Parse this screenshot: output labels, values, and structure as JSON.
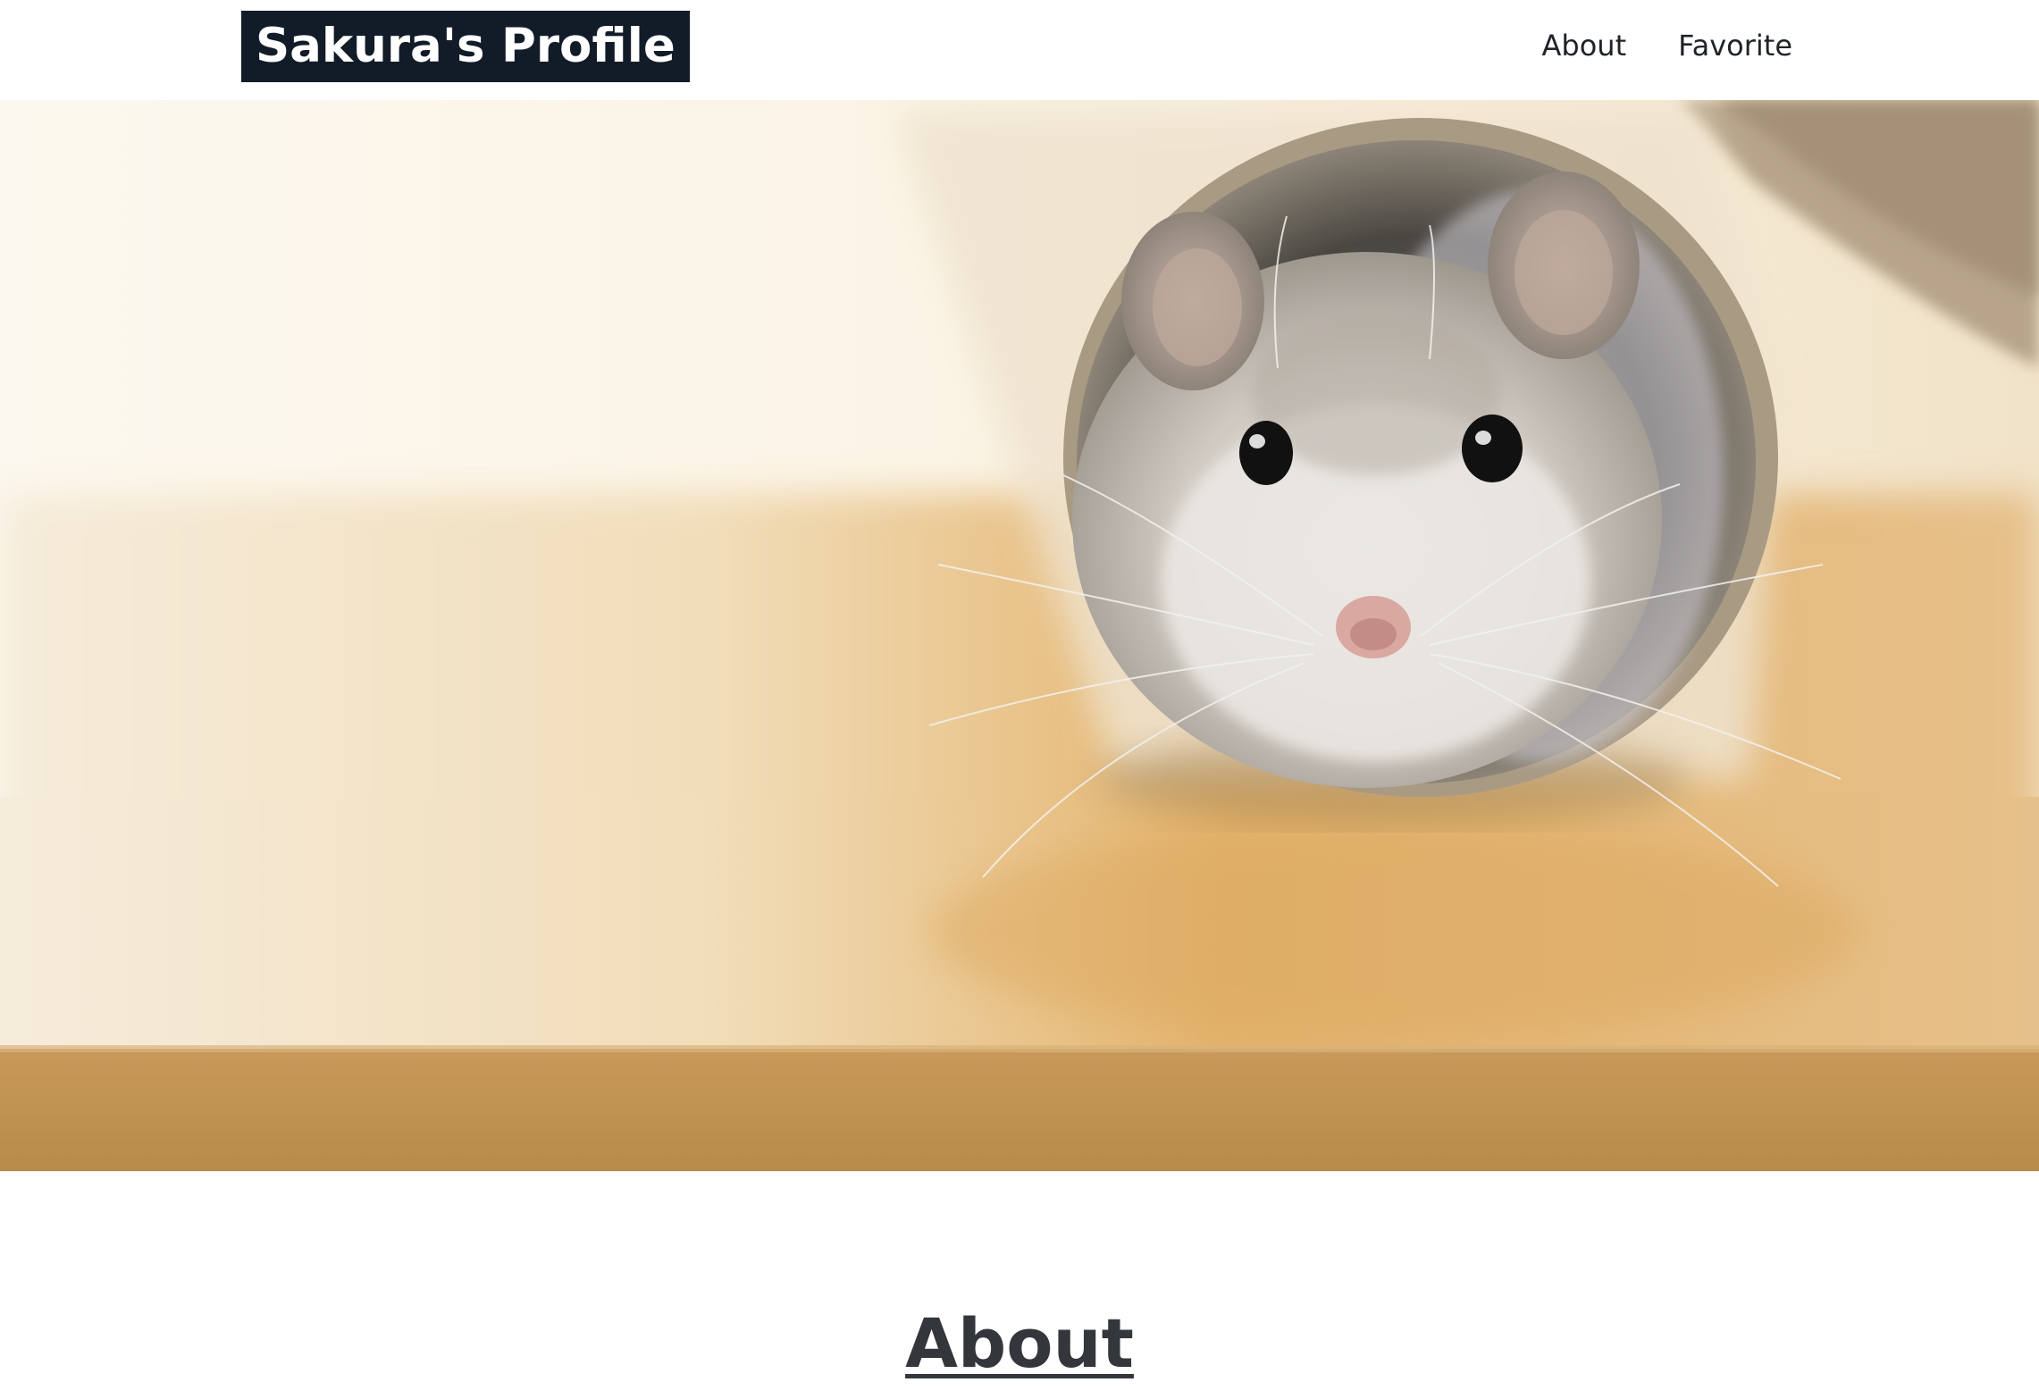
{
  "header": {
    "logo_text": "Sakura's Profile",
    "nav": [
      {
        "label": "About"
      },
      {
        "label": "Favorite"
      }
    ]
  },
  "hero": {
    "image": "hamster-in-tube-photo"
  },
  "about": {
    "title": "About"
  },
  "colors": {
    "logo_bg": "#121c28",
    "logo_text": "#ffffff",
    "nav_text": "#1f2328",
    "title_text": "#33363b"
  }
}
